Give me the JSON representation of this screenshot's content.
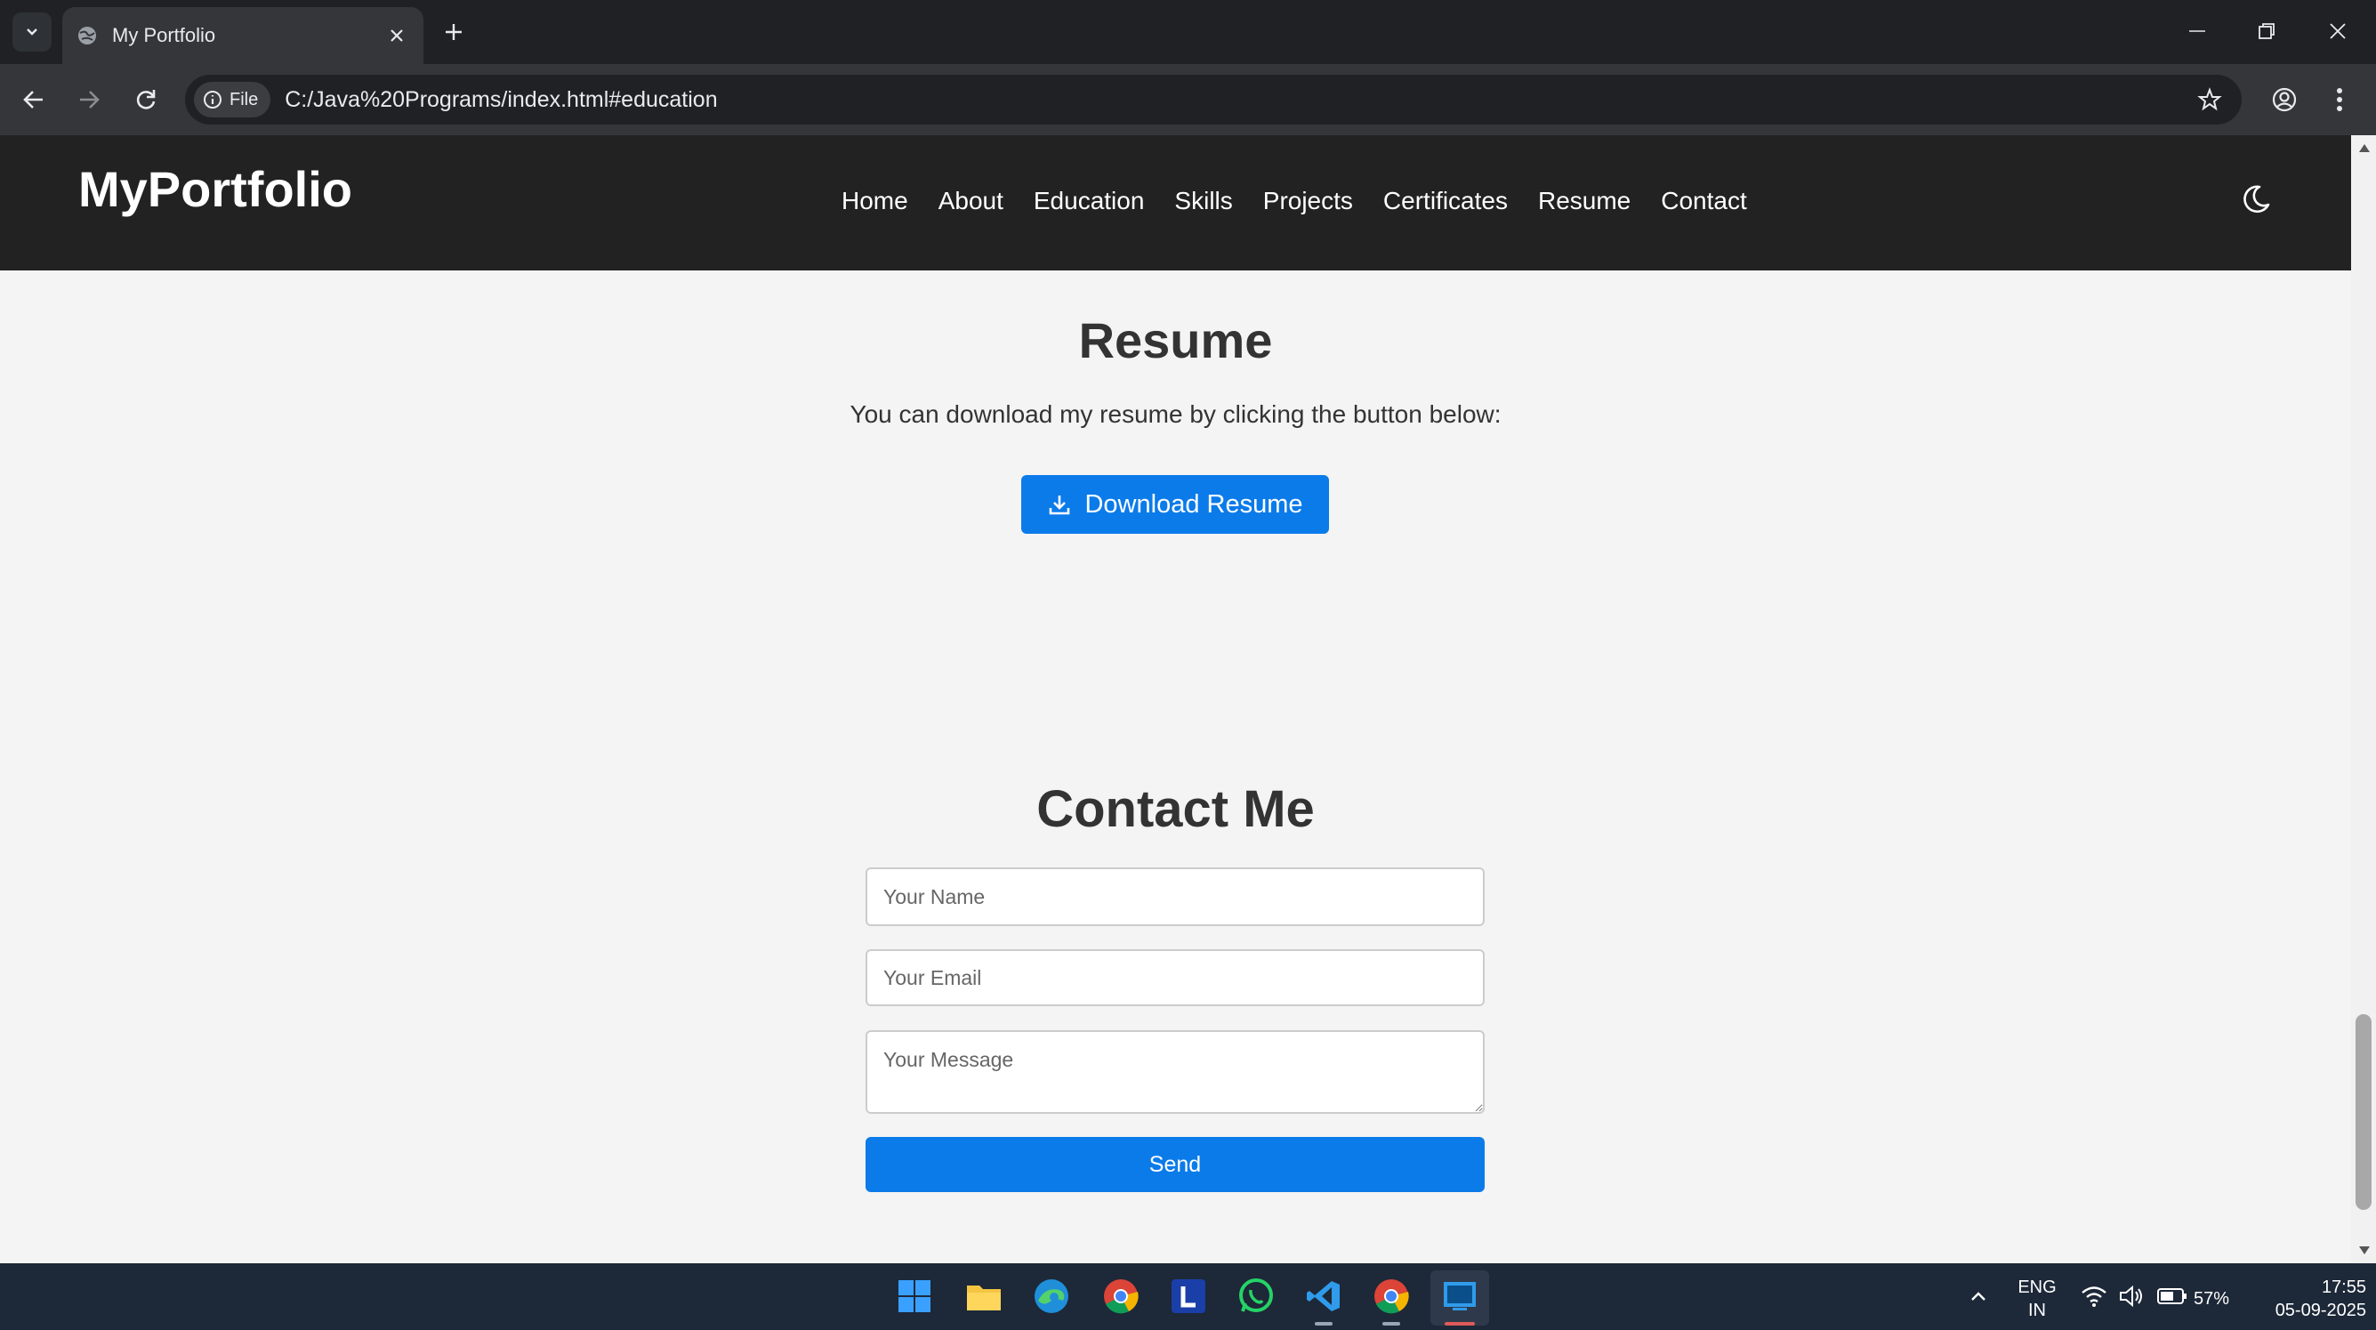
{
  "browser": {
    "tab_title": "My Portfolio",
    "chip_label": "File",
    "url": "C:/Java%20Programs/index.html#education"
  },
  "site": {
    "logo": "MyPortfolio",
    "nav": [
      "Home",
      "About",
      "Education",
      "Skills",
      "Projects",
      "Certificates",
      "Resume",
      "Contact"
    ]
  },
  "resume": {
    "heading": "Resume",
    "text": "You can download my resume by clicking the button below:",
    "button_label": "Download Resume"
  },
  "contact": {
    "heading": "Contact Me",
    "name_placeholder": "Your Name",
    "email_placeholder": "Your Email",
    "message_placeholder": "Your Message",
    "send_label": "Send"
  },
  "taskbar": {
    "lang_top": "ENG",
    "lang_bottom": "IN",
    "battery": "57%",
    "time": "17:55",
    "date": "05-09-2025"
  },
  "colors": {
    "accent": "#0b7bea",
    "header_bg": "#222222",
    "page_bg": "#f4f4f4"
  }
}
